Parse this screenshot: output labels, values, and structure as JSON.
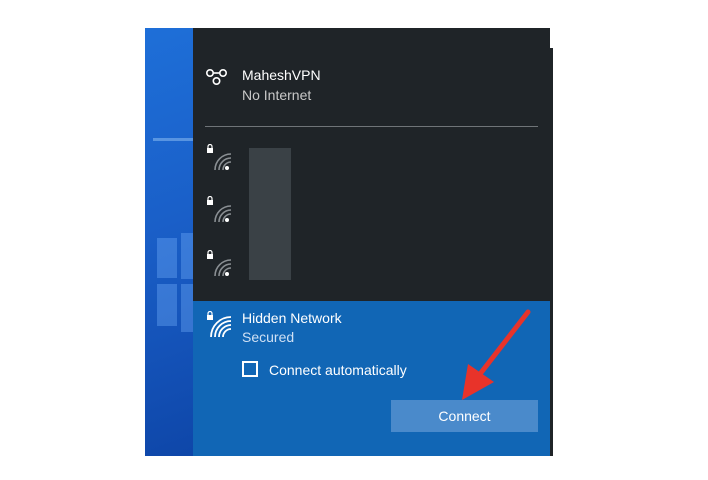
{
  "vpn": {
    "name": "MaheshVPN",
    "status": "No Internet"
  },
  "networks": [
    {
      "icon": "wifi-locked-icon",
      "name": ""
    },
    {
      "icon": "wifi-locked-icon",
      "name": ""
    },
    {
      "icon": "wifi-locked-icon",
      "name": ""
    }
  ],
  "hidden_network": {
    "name": "Hidden Network",
    "status": "Secured",
    "connect_automatically_label": "Connect automatically",
    "connect_automatically_checked": false,
    "connect_button_label": "Connect"
  },
  "colors": {
    "flyout_bg": "#1f2428",
    "selected_bg": "#1166b5",
    "button_bg": "#4a8acb",
    "annotation_arrow": "#e8332a"
  }
}
